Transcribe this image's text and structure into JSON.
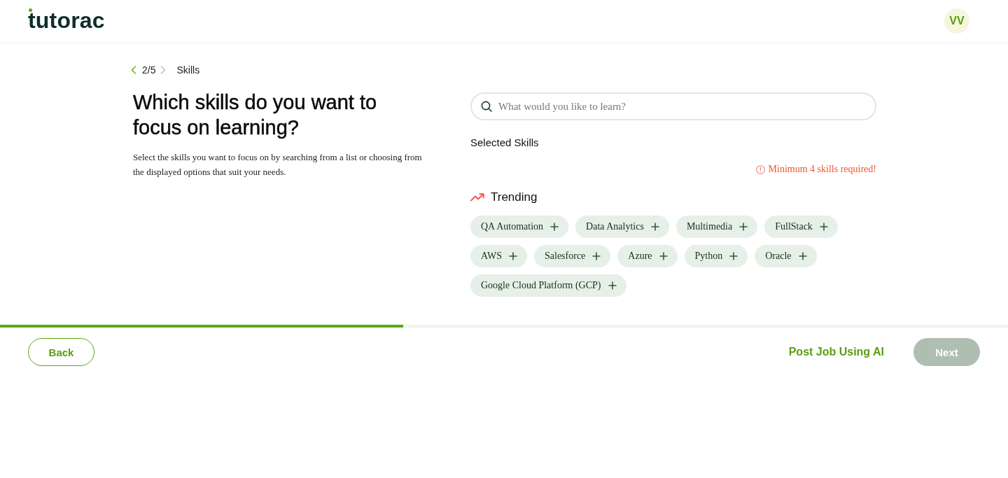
{
  "header": {
    "logo": "tutorac",
    "avatar": {
      "initials": "VV"
    }
  },
  "breadcrumb": {
    "previous": {
      "disabled": false
    },
    "step": "2/5",
    "next": {
      "disabled": true
    },
    "label": "Skills"
  },
  "intro": {
    "title": "Which skills do you want to focus on learning?",
    "description": "Select the skills you want to focus on by searching from a list or choosing from the displayed options that suit your needs."
  },
  "search": {
    "placeholder": "What would you like to learn?"
  },
  "selected_skills": {
    "heading": "Selected Skills",
    "warning": "Minimum 4 skills required!"
  },
  "trending": {
    "heading": "Trending",
    "skills": [
      "QA Automation",
      "Data Analytics",
      "Multimedia",
      "FullStack",
      "AWS",
      "Salesforce",
      "Azure",
      "Python",
      "Oracle",
      "Google Cloud Platform (GCP)"
    ]
  },
  "progress": {
    "level": 0.4
  },
  "footer": {
    "back": {
      "label": "Back"
    },
    "ai_link": "Post Job Using AI",
    "next": {
      "label": "Next",
      "disabled": true
    }
  }
}
